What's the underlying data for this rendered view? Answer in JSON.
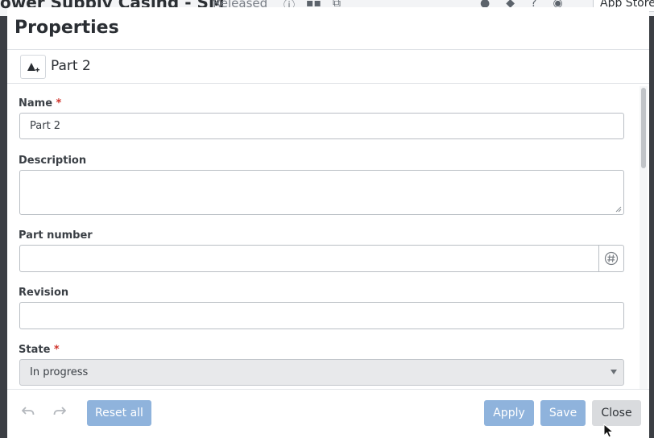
{
  "background_app": {
    "title": "ower Supply Casing - SM",
    "status": "Released",
    "app_store_label": "App Store"
  },
  "dialog": {
    "title": "Properties",
    "part_name": "Part 2",
    "fields": {
      "name": {
        "label": "Name",
        "required_mark": "*",
        "value": "Part 2"
      },
      "description": {
        "label": "Description",
        "value": ""
      },
      "part_number": {
        "label": "Part number",
        "value": ""
      },
      "revision": {
        "label": "Revision",
        "value": ""
      },
      "state": {
        "label": "State",
        "required_mark": "*",
        "value": "In progress"
      }
    },
    "footer": {
      "reset_all": "Reset all",
      "apply": "Apply",
      "save": "Save",
      "close": "Close"
    }
  },
  "icons": {
    "part_icon": "add-part-icon",
    "part_number_generate": "hash-icon",
    "undo": "undo-icon",
    "redo": "redo-icon"
  },
  "colors": {
    "primary_button": "#8fb3dc",
    "secondary_button": "#d9dbde",
    "required": "#d0342c"
  }
}
